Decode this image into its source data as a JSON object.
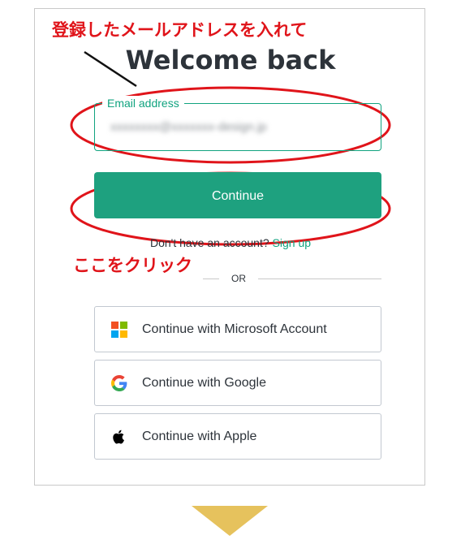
{
  "annotations": {
    "top_note": "登録したメールアドレスを入れて",
    "mid_note": "ここをクリック",
    "accent_color": "#e0141a"
  },
  "login": {
    "title": "Welcome back",
    "email": {
      "label": "Email address",
      "value": "xxxxxxxx@xxxxxxx-design.jp"
    },
    "continue_label": "Continue",
    "signup_prompt": "Don't have an account?",
    "signup_link": "Sign up",
    "divider_text": "OR",
    "social": [
      {
        "label": "Continue with Microsoft Account",
        "icon": "microsoft-icon"
      },
      {
        "label": "Continue with Google",
        "icon": "google-icon"
      },
      {
        "label": "Continue with Apple",
        "icon": "apple-icon"
      }
    ],
    "brand_color": "#10a37f"
  },
  "arrow": {
    "color": "#e6c25d",
    "icon": "arrow-down-icon"
  }
}
